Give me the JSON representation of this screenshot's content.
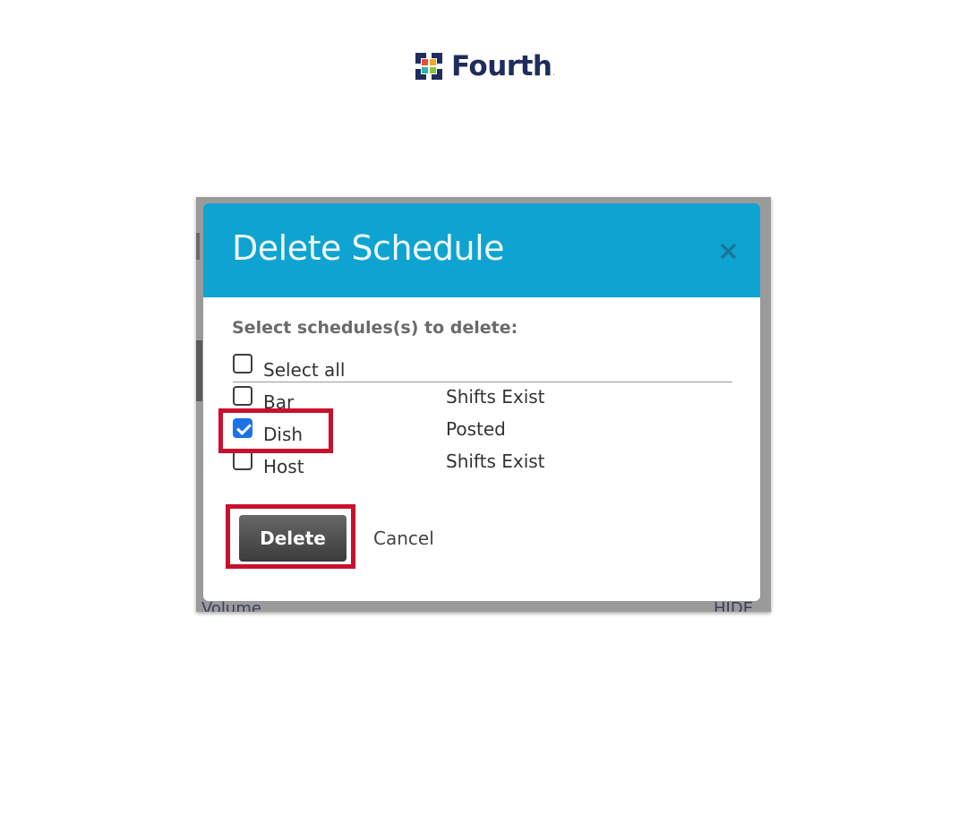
{
  "brand": {
    "name": "Fourth",
    "tm": "."
  },
  "background": {
    "bottom_left_text": "Volume",
    "bottom_right_text": "HIDE"
  },
  "dialog": {
    "title": "Delete Schedule",
    "close_symbol": "×",
    "prompt": "Select schedules(s) to delete:",
    "select_all_label": "Select all",
    "rows": [
      {
        "label": "Bar",
        "status": "Shifts Exist",
        "checked": false
      },
      {
        "label": "Dish",
        "status": "Posted",
        "checked": true
      },
      {
        "label": "Host",
        "status": "Shifts Exist",
        "checked": false
      }
    ],
    "delete_label": "Delete",
    "cancel_label": "Cancel"
  },
  "colors": {
    "header": "#0ea3d0",
    "highlight": "#c9102e",
    "checkbox_checked": "#1a73e8",
    "brand_text": "#1f2d5c"
  },
  "icons": [
    "fourth-logo-icon",
    "close-icon",
    "checkbox-icon"
  ]
}
